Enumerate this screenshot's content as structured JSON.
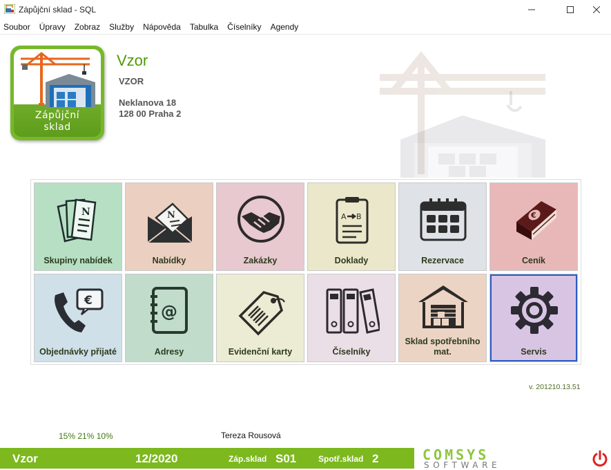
{
  "window": {
    "title": "Zápůjční sklad - SQL",
    "min": "—",
    "max": "☐",
    "close": "✕"
  },
  "menu": [
    "Soubor",
    "Úpravy",
    "Zobraz",
    "Služby",
    "Nápověda",
    "Tabulka",
    "Číselníky",
    "Agendy"
  ],
  "logo": {
    "line1": "Zápůjční",
    "line2": "sklad"
  },
  "company": {
    "title": "Vzor",
    "code": "VZOR",
    "address1": "Neklanova 18",
    "address2": "128 00 Praha 2"
  },
  "tiles": [
    {
      "label": "Skupiny nabídek",
      "color": "#b7dfc4",
      "icon": "offer-groups-icon"
    },
    {
      "label": "Nabídky",
      "color": "#ebcfc0",
      "icon": "offer-envelope-icon"
    },
    {
      "label": "Zakázky",
      "color": "#e7c9cf",
      "icon": "handshake-icon"
    },
    {
      "label": "Doklady",
      "color": "#ebe7ca",
      "icon": "document-clipboard-icon"
    },
    {
      "label": "Rezervace",
      "color": "#dfe2e6",
      "icon": "calendar-icon"
    },
    {
      "label": "Ceník",
      "color": "#e8b8b9",
      "icon": "price-book-icon"
    },
    {
      "label": "Objednávky přijaté",
      "color": "#cfe0e8",
      "icon": "phone-euro-icon"
    },
    {
      "label": "Adresy",
      "color": "#c1dccb",
      "icon": "address-book-icon"
    },
    {
      "label": "Evidenční karty",
      "color": "#ecebd4",
      "icon": "barcode-tag-icon"
    },
    {
      "label": "Číselníky",
      "color": "#eadfe6",
      "icon": "binders-icon"
    },
    {
      "label": "Sklad spotřebního mat.",
      "color": "#ecd4c4",
      "icon": "warehouse-icon"
    },
    {
      "label": "Servis",
      "color": "#d8c5e3",
      "icon": "gear-icon"
    }
  ],
  "version": "v. 201210.13.51",
  "stats": "15% 21% 10%",
  "user": "Tereza Rousová",
  "statusbar": {
    "company": "Vzor",
    "period": "12/2020",
    "zap_label": "Záp.sklad",
    "zap_value": "S01",
    "spot_label": "Spotř.sklad",
    "spot_value": "2"
  },
  "brand": {
    "top": "COMSYS",
    "bottom": "SOFTWARE",
    "accent": "#8cc63f"
  },
  "colors": {
    "green": "#7cb81e",
    "power": "#e02020"
  }
}
